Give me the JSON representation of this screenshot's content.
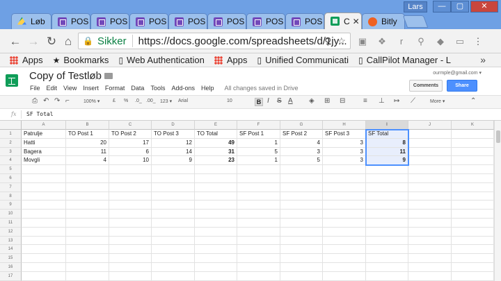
{
  "browser": {
    "tabs": [
      {
        "label": "Løb",
        "icon": "drive-icon"
      },
      {
        "label": "POS",
        "icon": "forms-icon"
      },
      {
        "label": "POS",
        "icon": "forms-icon"
      },
      {
        "label": "POS",
        "icon": "forms-icon"
      },
      {
        "label": "POS",
        "icon": "forms-icon"
      },
      {
        "label": "POS",
        "icon": "forms-icon"
      },
      {
        "label": "POS",
        "icon": "forms-icon"
      },
      {
        "label": "POS",
        "icon": "forms-icon"
      },
      {
        "label": "C",
        "icon": "sheets-icon"
      },
      {
        "label": "Bitly",
        "icon": "bitly-icon"
      }
    ],
    "user": "Lars",
    "secure_label": "Sikker",
    "url": "https://docs.google.com/spreadsheets/d/1jy..."
  },
  "bookmarks": [
    {
      "label": "Apps",
      "icon": "apps-icon"
    },
    {
      "label": "Bookmarks",
      "icon": "star-icon"
    },
    {
      "label": "Web Authentication",
      "icon": "page-icon"
    },
    {
      "label": "Apps",
      "icon": "apps-icon"
    },
    {
      "label": "Unified Communicati",
      "icon": "page-icon"
    },
    {
      "label": "CallPilot Manager - L",
      "icon": "page-icon"
    }
  ],
  "bookmarks_more": "»",
  "sheet": {
    "title": "Copy of Testløb",
    "menu": [
      "File",
      "Edit",
      "View",
      "Insert",
      "Format",
      "Data",
      "Tools",
      "Add-ons",
      "Help"
    ],
    "saved_status": "All changes saved in Drive",
    "email": "ourmple@gmail.com ▾",
    "comments_label": "Comments",
    "share_label": "Share",
    "toolbar": {
      "zoom": "100% ▾",
      "currency": "£",
      "percent": "%",
      "dec_less": ".0_",
      "dec_more": ".00_",
      "format_more": "123 ▾",
      "font": "Arial",
      "font_size": "10",
      "bold": "B",
      "more": "More ▾"
    },
    "formula_label": "fx",
    "formula_value": "SF Total",
    "columns": [
      "A",
      "B",
      "C",
      "D",
      "E",
      "F",
      "G",
      "H",
      "I",
      "J",
      "K"
    ],
    "rows": [
      [
        "Patrulje",
        "TO Post 1",
        "TO Post 2",
        "TO Post 3",
        "TO Total",
        "SF Post 1",
        "SF Post 2",
        "SF Post 3",
        "SF Total",
        "",
        ""
      ],
      [
        "Hatti",
        "20",
        "17",
        "12",
        "49",
        "1",
        "4",
        "3",
        "8",
        "",
        ""
      ],
      [
        "Bagera",
        "11",
        "6",
        "14",
        "31",
        "5",
        "3",
        "3",
        "11",
        "",
        ""
      ],
      [
        "Movgli",
        "4",
        "10",
        "9",
        "23",
        "1",
        "5",
        "3",
        "9",
        "",
        ""
      ],
      [
        "",
        "",
        "",
        "",
        "",
        "",
        "",
        "",
        "",
        "",
        ""
      ],
      [
        "",
        "",
        "",
        "",
        "",
        "",
        "",
        "",
        "",
        "",
        ""
      ],
      [
        "",
        "",
        "",
        "",
        "",
        "",
        "",
        "",
        "",
        "",
        ""
      ],
      [
        "",
        "",
        "",
        "",
        "",
        "",
        "",
        "",
        "",
        "",
        ""
      ],
      [
        "",
        "",
        "",
        "",
        "",
        "",
        "",
        "",
        "",
        "",
        ""
      ],
      [
        "",
        "",
        "",
        "",
        "",
        "",
        "",
        "",
        "",
        "",
        ""
      ],
      [
        "",
        "",
        "",
        "",
        "",
        "",
        "",
        "",
        "",
        "",
        ""
      ],
      [
        "",
        "",
        "",
        "",
        "",
        "",
        "",
        "",
        "",
        "",
        ""
      ],
      [
        "",
        "",
        "",
        "",
        "",
        "",
        "",
        "",
        "",
        "",
        ""
      ],
      [
        "",
        "",
        "",
        "",
        "",
        "",
        "",
        "",
        "",
        "",
        ""
      ],
      [
        "",
        "",
        "",
        "",
        "",
        "",
        "",
        "",
        "",
        "",
        ""
      ],
      [
        "",
        "",
        "",
        "",
        "",
        "",
        "",
        "",
        "",
        "",
        ""
      ],
      [
        "",
        "",
        "",
        "",
        "",
        "",
        "",
        "",
        "",
        "",
        ""
      ],
      [
        "",
        "",
        "",
        "",
        "",
        "",
        "",
        "",
        "",
        "",
        ""
      ]
    ]
  }
}
